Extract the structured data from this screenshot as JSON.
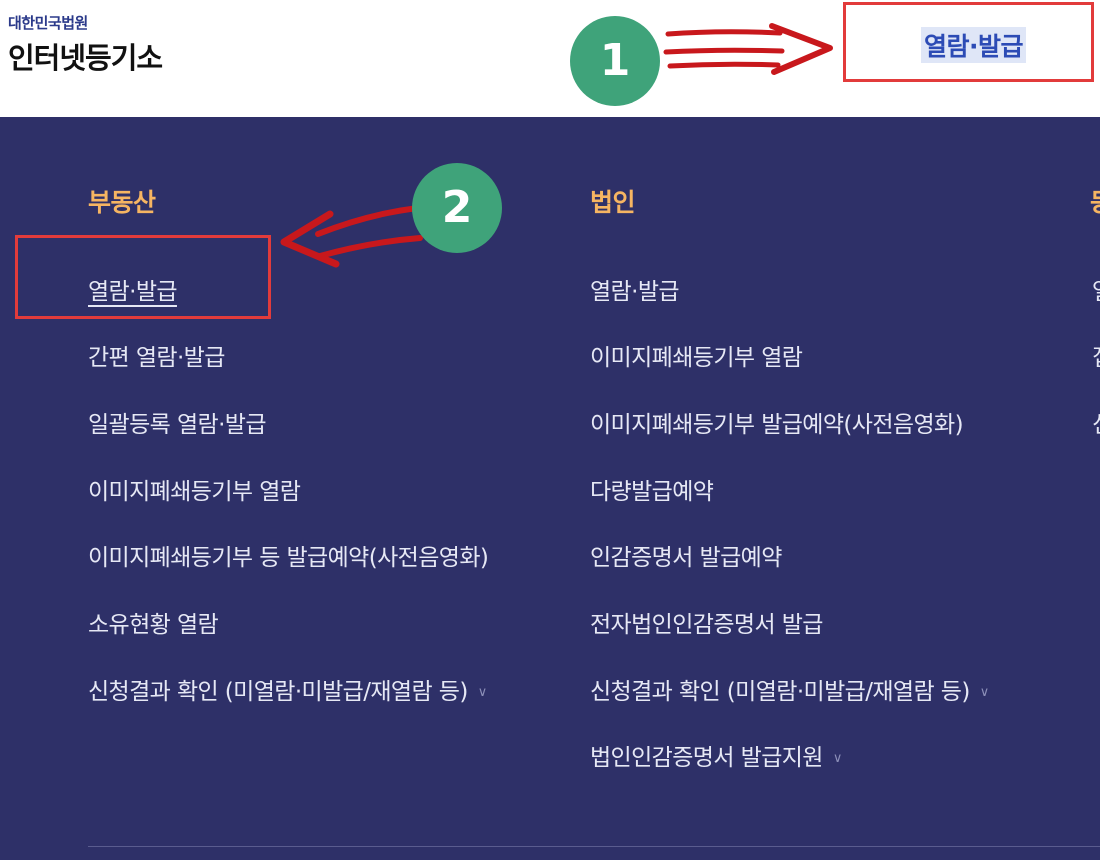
{
  "logo": {
    "sub": "대한민국법원",
    "main": "인터넷등기소"
  },
  "top_nav": {
    "label": "열람·발급"
  },
  "badges": [
    "1",
    "2"
  ],
  "menu": {
    "columns": [
      {
        "heading": "부동산",
        "items": [
          {
            "label": "열람·발급"
          },
          {
            "label": "간편 열람·발급"
          },
          {
            "label": "일괄등록 열람·발급"
          },
          {
            "label": "이미지폐쇄등기부 열람"
          },
          {
            "label": "이미지폐쇄등기부 등 발급예약(사전음영화)"
          },
          {
            "label": "소유현황 열람"
          },
          {
            "label": "신청결과 확인 (미열람·미발급/재열람 등)"
          }
        ]
      },
      {
        "heading": "법인",
        "items": [
          {
            "label": "열람·발급"
          },
          {
            "label": "이미지폐쇄등기부 열람"
          },
          {
            "label": "이미지폐쇄등기부 발급예약(사전음영화)"
          },
          {
            "label": "다량발급예약"
          },
          {
            "label": "인감증명서 발급예약"
          },
          {
            "label": "전자법인인감증명서 발급"
          },
          {
            "label": "신청결과 확인 (미열람·미발급/재열람 등)"
          },
          {
            "label": "법인인감증명서 발급지원"
          }
        ]
      },
      {
        "heading": "동",
        "items": [
          {
            "label": "열"
          },
          {
            "label": "집"
          },
          {
            "label": "신"
          }
        ]
      }
    ]
  },
  "colors": {
    "nav_bg": "#2e3068",
    "heading": "#f6b562",
    "highlight_box": "#e23b3b",
    "badge": "#3fa37a",
    "arrow": "#c8181c"
  }
}
